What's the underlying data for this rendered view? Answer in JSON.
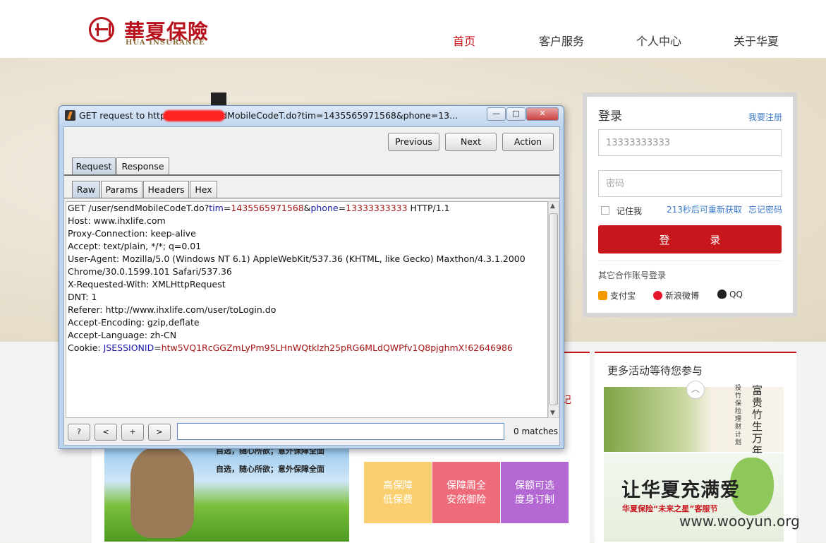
{
  "site": {
    "logo_cn": "華夏保險",
    "logo_en": "HUA INSURANCE",
    "nav": [
      "首页",
      "客户服务",
      "个人中心",
      "关于华夏"
    ],
    "accent": "#c8161d"
  },
  "login": {
    "title": "登录",
    "register": "我要注册",
    "phone_value": "13333333333",
    "password_placeholder": "密码",
    "remember": "记住我",
    "resend": "213秒后可重新获取",
    "forgot": "忘记密码",
    "submit": "登 录",
    "other_login": "其它合作账号登录",
    "oauth": [
      "支付宝",
      "新浪微博",
      "QQ"
    ]
  },
  "page": {
    "more_activities": "更多活动等待您参与",
    "features": [
      {
        "line1": "高保障",
        "line2": "低保费",
        "color": "#f9cf6f"
      },
      {
        "line1": "保障周全",
        "line2": "安然御险",
        "color": "#ef6b79"
      },
      {
        "line1": "保额可选",
        "line2": "度身订制",
        "color": "#b468d4"
      }
    ],
    "bear_text1": "自选，随心所欲；意外保障全面",
    "bear_text2": "自选，随心所欲；意外保障全面",
    "promo1_big": "富贵竹生万年",
    "promo1_small": "投竹保险理财计划",
    "promo2_title": "让华夏充满爱",
    "promo2_sub": "华夏保险“未来之星”客服节",
    "side_char": "记",
    "watermark": "www.wooyun.org"
  },
  "dialog": {
    "title": "GET request to http://                    t/user/sendMobileCodeT.do?tim=1435565971568&phone=13...",
    "win_buttons": [
      "—",
      "□",
      "✕"
    ],
    "buttons": [
      "Previous",
      "Next",
      "Action"
    ],
    "tabs_top": [
      "Request",
      "Response"
    ],
    "tabs_sub": [
      "Raw",
      "Params",
      "Headers",
      "Hex"
    ],
    "request_lines": [
      [
        {
          "t": "GET /user/sendMobileCodeT.do?"
        },
        {
          "t": "tim",
          "c": "k"
        },
        {
          "t": "="
        },
        {
          "t": "1435565971568",
          "c": "v"
        },
        {
          "t": "&"
        },
        {
          "t": "phone",
          "c": "k"
        },
        {
          "t": "="
        },
        {
          "t": "13333333333",
          "c": "v"
        },
        {
          "t": " HTTP/1.1"
        }
      ],
      [
        {
          "t": "Host: www.ihxlife.com"
        }
      ],
      [
        {
          "t": "Proxy-Connection: keep-alive"
        }
      ],
      [
        {
          "t": "Accept: text/plain, */*; q=0.01"
        }
      ],
      [
        {
          "t": "User-Agent: Mozilla/5.0 (Windows NT 6.1) AppleWebKit/537.36 (KHTML, like Gecko) Maxthon/4.3.1.2000"
        }
      ],
      [
        {
          "t": "Chrome/30.0.1599.101 Safari/537.36"
        }
      ],
      [
        {
          "t": "X-Requested-With: XMLHttpRequest"
        }
      ],
      [
        {
          "t": "DNT: 1"
        }
      ],
      [
        {
          "t": "Referer: http://www.ihxlife.com/user/toLogin.do"
        }
      ],
      [
        {
          "t": "Accept-Encoding: gzip,deflate"
        }
      ],
      [
        {
          "t": "Accept-Language: zh-CN"
        }
      ],
      [
        {
          "t": "Cookie: "
        },
        {
          "t": "JSESSIONID",
          "c": "k"
        },
        {
          "t": "="
        },
        {
          "t": "htw5VQ1RcGGZmLyPm95LHnWQtklzh25pRG6MLdQWPfv1Q8pjghmX!62646986",
          "c": "v"
        }
      ]
    ],
    "search_buttons": [
      "?",
      "<",
      "+",
      ">"
    ],
    "search_value": "",
    "matches": "0 matches"
  }
}
